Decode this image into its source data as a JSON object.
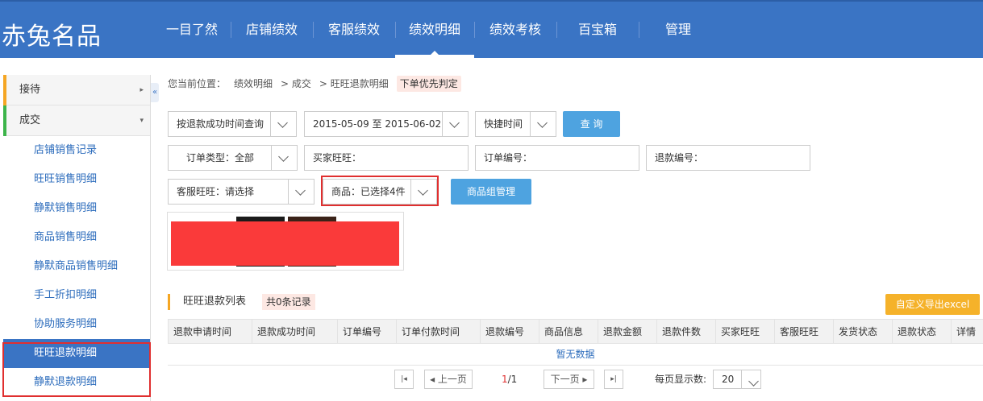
{
  "app": {
    "logo": "赤兔名品"
  },
  "nav": [
    {
      "label": "一目了然",
      "active": false
    },
    {
      "label": "店铺绩效",
      "active": false
    },
    {
      "label": "客服绩效",
      "active": false
    },
    {
      "label": "绩效明细",
      "active": true
    },
    {
      "label": "绩效考核",
      "active": false
    },
    {
      "label": "百宝箱",
      "active": false
    },
    {
      "label": "管理",
      "active": false
    }
  ],
  "sidebar": {
    "groups": [
      {
        "label": "接待",
        "bar_color": "#f5a623",
        "arrow": "▸"
      },
      {
        "label": "成交",
        "bar_color": "#3cb44a",
        "arrow": "▾"
      }
    ],
    "items": [
      {
        "label": "店铺销售记录"
      },
      {
        "label": "旺旺销售明细"
      },
      {
        "label": "静默销售明细"
      },
      {
        "label": "商品销售明细"
      },
      {
        "label": "静默商品销售明细"
      },
      {
        "label": "手工折扣明细"
      },
      {
        "label": "协助服务明细"
      },
      {
        "label": "旺旺退款明细"
      },
      {
        "label": "静默退款明细"
      }
    ],
    "active_index": 7,
    "collapse_label": "«"
  },
  "breadcrumb": {
    "prefix": "您当前位置：",
    "items": [
      "绩效明细",
      "> 成交",
      "> 旺旺退款明细"
    ],
    "tag": "下单优先判定"
  },
  "filters": {
    "time_mode": "按退款成功时间查询",
    "date_range": "2015-05-09 至 2015-06-02",
    "quick_time": "快捷时间",
    "query_button": "查 询",
    "order_type": "订单类型：全部",
    "buyer_ww": "买家旺旺：",
    "order_no": "订单编号：",
    "refund_no": "退款编号：",
    "cs_ww": "客服旺旺：请选择",
    "goods": "商品：已选择4件",
    "goods_group_button": "商品组管理"
  },
  "list": {
    "title": "旺旺退款列表",
    "count": "共0条记录",
    "export_button": "自定义导出excel",
    "columns": [
      "退款申请时间",
      "退款成功时间",
      "订单编号",
      "订单付款时间",
      "退款编号",
      "商品信息",
      "退款金额",
      "退款件数",
      "买家旺旺",
      "客服旺旺",
      "发货状态",
      "退款状态",
      "详情"
    ],
    "empty_text": "暂无数据"
  },
  "pager": {
    "first": "|◂",
    "prev": "◂ 上一页",
    "current": "1",
    "total": "/1",
    "next": "下一页 ▸",
    "last": "▸|",
    "page_size_label": "每页显示数:",
    "page_size": "20"
  }
}
